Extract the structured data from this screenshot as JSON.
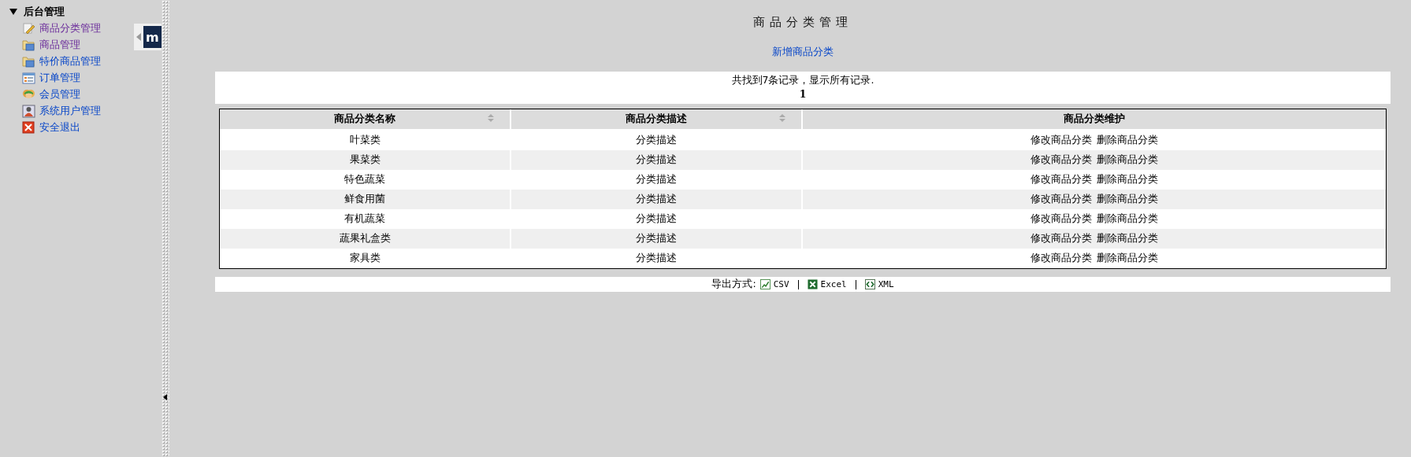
{
  "sidebar": {
    "root": {
      "label": "后台管理",
      "expanded": true,
      "children": [
        {
          "label": "商品分类管理",
          "kind": "edit",
          "visited": true
        },
        {
          "label": "商品管理",
          "kind": "folder",
          "visited": true
        },
        {
          "label": "特价商品管理",
          "kind": "folder",
          "visited": false
        },
        {
          "label": "订单管理",
          "kind": "list",
          "visited": false
        },
        {
          "label": "会员管理",
          "kind": "users",
          "visited": false
        },
        {
          "label": "系统用户管理",
          "kind": "user",
          "visited": false
        },
        {
          "label": "安全退出",
          "kind": "exit",
          "visited": false
        }
      ]
    }
  },
  "floating_tab": {
    "logo_text": "m"
  },
  "page": {
    "title": "商品分类管理",
    "add_link": "新增商品分类"
  },
  "summary": {
    "text": "共找到7条记录，显示所有记录.",
    "pages": [
      {
        "label": "1",
        "selected": true
      }
    ]
  },
  "table": {
    "columns": [
      {
        "label": "商品分类名称",
        "sortable": true
      },
      {
        "label": "商品分类描述",
        "sortable": true
      },
      {
        "label": "商品分类维护",
        "sortable": false
      }
    ],
    "rows": [
      {
        "name": "叶菜类",
        "description": "分类描述",
        "actions": [
          "修改商品分类",
          "删除商品分类"
        ]
      },
      {
        "name": "果菜类",
        "description": "分类描述",
        "actions": [
          "修改商品分类",
          "删除商品分类"
        ]
      },
      {
        "name": "特色蔬菜",
        "description": "分类描述",
        "actions": [
          "修改商品分类",
          "删除商品分类"
        ]
      },
      {
        "name": "鲜食用菌",
        "description": "分类描述",
        "actions": [
          "修改商品分类",
          "删除商品分类"
        ]
      },
      {
        "name": "有机蔬菜",
        "description": "分类描述",
        "actions": [
          "修改商品分类",
          "删除商品分类"
        ]
      },
      {
        "name": "蔬果礼盒类",
        "description": "分类描述",
        "actions": [
          "修改商品分类",
          "删除商品分类"
        ]
      },
      {
        "name": "家具类",
        "description": "分类描述",
        "actions": [
          "修改商品分类",
          "删除商品分类"
        ]
      }
    ]
  },
  "export": {
    "label": "导出方式:",
    "formats": [
      {
        "label": "CSV",
        "kind": "csv"
      },
      {
        "label": "Excel",
        "kind": "excel"
      },
      {
        "label": "XML",
        "kind": "xml"
      }
    ]
  }
}
